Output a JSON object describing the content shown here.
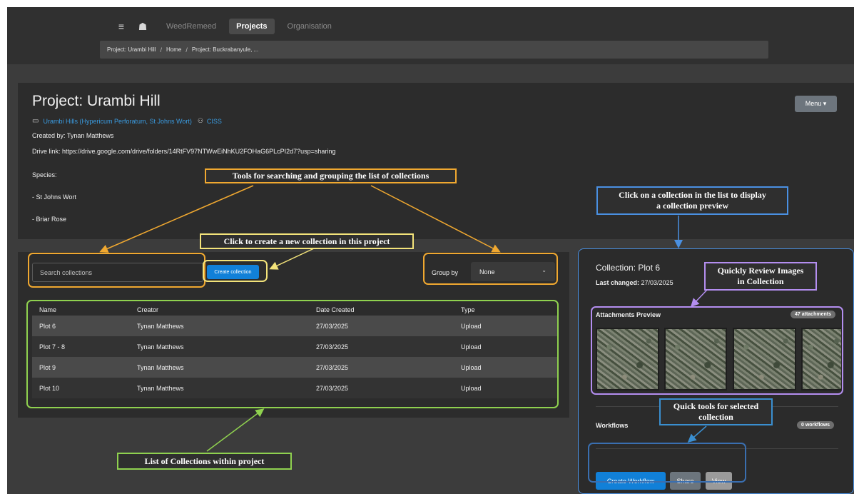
{
  "nav": {
    "menu_icon": "hamburger-icon",
    "home_icon": "home-icon",
    "links": [
      "WeedRemeed",
      "Projects",
      "Organisation"
    ],
    "active": "Projects"
  },
  "breadcrumb": {
    "items": [
      "Project: Urambi Hill",
      "Home",
      "Project: Buckrabanyule, ..."
    ],
    "separator": "/"
  },
  "project": {
    "title": "Project: Urambi Hill",
    "subject_link": "Urambi Hills (Hypericum Perforatum, St Johns Wort)",
    "org_link": "CISS",
    "created_by": "Created by: Tynan Matthews",
    "drive_link": "Drive link: https://drive.google.com/drive/folders/14RtFV97NTWwEiNhKU2FOHaG6PLcPI2d7?usp=sharing",
    "species_label": "Species:",
    "species": [
      "- St Johns Wort",
      "- Briar Rose"
    ],
    "menu_label": "Menu ▾"
  },
  "collections": {
    "search_placeholder": "Search collections",
    "create_label": "Create collection",
    "group_by_label": "Group by",
    "group_by_value": "None",
    "columns": [
      "Name",
      "Creator",
      "Date Created",
      "Type"
    ],
    "rows": [
      [
        "Plot 6",
        "Tynan Matthews",
        "27/03/2025",
        "Upload"
      ],
      [
        "Plot 7 - 8",
        "Tynan Matthews",
        "27/03/2025",
        "Upload"
      ],
      [
        "Plot 9",
        "Tynan Matthews",
        "27/03/2025",
        "Upload"
      ],
      [
        "Plot 10",
        "Tynan Matthews",
        "27/03/2025",
        "Upload"
      ]
    ]
  },
  "preview": {
    "title": "Collection: Plot 6",
    "last_changed_label": "Last changed:",
    "last_changed_value": "27/03/2025",
    "attachments_label": "Attachments Preview",
    "attachments_badge": "47 attachments",
    "workflows_label": "Workflows",
    "workflows_badge": "0 workflows",
    "buttons": {
      "create_workflow": "Create Workflow",
      "share": "Share",
      "view": "View"
    }
  },
  "annotations": {
    "search_tools": "Tools for searching and grouping the list of collections",
    "create_new": "Click to create a new collection in this project",
    "click_collection": [
      "Click on a collection in the list to display",
      "a collection preview"
    ],
    "review_images": [
      "Quickly Review Images",
      "in Collection"
    ],
    "quick_tools": [
      "Quick tools for selected",
      "collection"
    ],
    "list_label": "List of Collections within project"
  },
  "colors": {
    "accent_blue": "#1180d8",
    "link_blue": "#3a9be0",
    "annotation_orange": "#f0a830",
    "annotation_yellow": "#f3e37a",
    "annotation_green": "#8fd14f",
    "annotation_blue": "#4a90e2",
    "annotation_purple": "#b48ef0"
  }
}
